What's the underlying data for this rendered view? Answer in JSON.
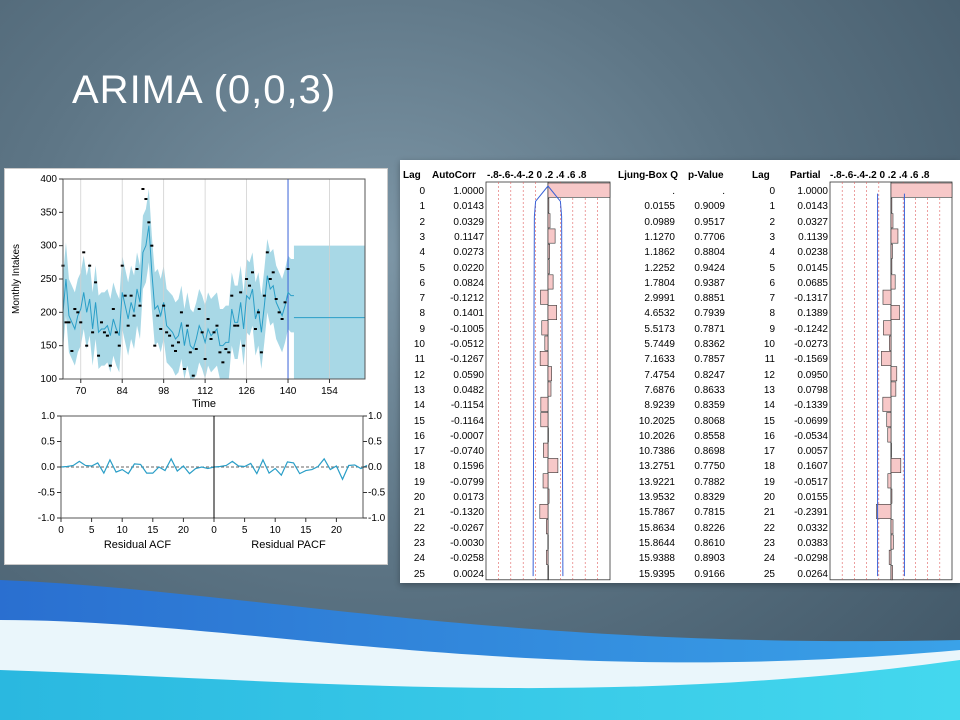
{
  "slide_title": "ARIMA (0,0,3)",
  "colors": {
    "band": "#a8d8e6",
    "line": "#2a9ec7",
    "bar_fill": "#f7c8c8",
    "bar_stroke": "#333333",
    "conf": "#3a62d8",
    "ref": "#e06060",
    "point": "#000000"
  },
  "chart_data": [
    {
      "type": "line",
      "name": "forecast",
      "ylabel": "Monthly Intakes",
      "xlabel": "Time",
      "xlim": [
        64,
        166
      ],
      "ylim": [
        100,
        400
      ],
      "x_ticks": [
        "70",
        "84",
        "98",
        "112",
        "126",
        "140",
        "154"
      ],
      "y_ticks": [
        "400",
        "350",
        "300",
        "250",
        "200",
        "150",
        "100"
      ],
      "forecast_start": 140,
      "actual": {
        "x": [
          64,
          65,
          66,
          67,
          68,
          69,
          70,
          71,
          72,
          73,
          74,
          75,
          76,
          77,
          78,
          79,
          80,
          81,
          82,
          83,
          84,
          85,
          86,
          87,
          88,
          89,
          90,
          91,
          92,
          93,
          94,
          95,
          96,
          97,
          98,
          99,
          100,
          101,
          102,
          103,
          104,
          105,
          106,
          107,
          108,
          109,
          110,
          111,
          112,
          113,
          114,
          115,
          116,
          117,
          118,
          119,
          120,
          121,
          122,
          123,
          124,
          125,
          126,
          127,
          128,
          129,
          130,
          131,
          132,
          133,
          134,
          135,
          136,
          137,
          138,
          139,
          140
        ],
        "y": [
          270,
          185,
          185,
          142,
          205,
          200,
          185,
          290,
          150,
          270,
          170,
          245,
          135,
          185,
          170,
          165,
          120,
          205,
          170,
          150,
          270,
          225,
          180,
          225,
          195,
          265,
          210,
          385,
          370,
          335,
          300,
          150,
          195,
          175,
          210,
          170,
          165,
          150,
          142,
          155,
          200,
          115,
          180,
          140,
          105,
          145,
          205,
          170,
          130,
          190,
          160,
          170,
          180,
          140,
          125,
          145,
          140,
          225,
          180,
          180,
          230,
          150,
          250,
          240,
          260,
          175,
          200,
          140,
          225,
          290,
          250,
          260,
          220,
          200,
          190,
          215,
          265
        ]
      },
      "fitted": {
        "x": [
          64,
          65,
          66,
          67,
          68,
          69,
          70,
          71,
          72,
          73,
          74,
          75,
          76,
          77,
          78,
          79,
          80,
          81,
          82,
          83,
          84,
          85,
          86,
          87,
          88,
          89,
          90,
          91,
          92,
          93,
          94,
          95,
          96,
          97,
          98,
          99,
          100,
          101,
          102,
          103,
          104,
          105,
          106,
          107,
          108,
          109,
          110,
          111,
          112,
          113,
          114,
          115,
          116,
          117,
          118,
          119,
          120,
          121,
          122,
          123,
          124,
          125,
          126,
          127,
          128,
          129,
          130,
          131,
          132,
          133,
          134,
          135,
          136,
          137,
          138,
          139,
          140,
          141,
          142
        ],
        "y": [
          200,
          250,
          195,
          185,
          175,
          195,
          205,
          230,
          200,
          220,
          175,
          215,
          170,
          175,
          175,
          180,
          165,
          190,
          175,
          165,
          230,
          210,
          190,
          215,
          200,
          235,
          215,
          290,
          300,
          330,
          260,
          205,
          210,
          195,
          215,
          180,
          175,
          170,
          160,
          165,
          185,
          150,
          175,
          150,
          145,
          160,
          180,
          170,
          155,
          175,
          165,
          170,
          175,
          150,
          150,
          155,
          155,
          205,
          185,
          185,
          215,
          175,
          225,
          220,
          235,
          190,
          205,
          170,
          210,
          255,
          235,
          240,
          215,
          205,
          195,
          210,
          230,
          225,
          225
        ]
      },
      "forecast": {
        "x": [
          142,
          166
        ],
        "y": [
          192,
          192
        ]
      },
      "band_upper_forecast": 300,
      "band_lower_forecast": 100
    },
    {
      "type": "line",
      "name": "residual_acf_pacf",
      "xlabel_left": "Residual ACF",
      "xlabel_right": "Residual PACF",
      "ylim": [
        -1,
        1
      ],
      "y_ticks": [
        "1.0",
        "0.5",
        "0.0",
        "-0.5",
        "-1.0"
      ],
      "x_ticks": [
        "0",
        "5",
        "10",
        "15",
        "20",
        "0",
        "5",
        "10",
        "15",
        "20"
      ],
      "acf": [
        0.0,
        0.01,
        0.03,
        0.11,
        0.03,
        0.02,
        0.08,
        -0.12,
        0.14,
        -0.1,
        -0.05,
        -0.13,
        0.06,
        0.05,
        -0.12,
        -0.12,
        0.0,
        -0.07,
        0.16,
        -0.08,
        0.02,
        -0.13,
        -0.03,
        0.0,
        -0.03,
        0.0
      ],
      "pacf": [
        0.0,
        0.01,
        0.03,
        0.11,
        0.02,
        0.01,
        0.07,
        -0.13,
        0.14,
        -0.12,
        -0.03,
        -0.16,
        0.1,
        0.08,
        -0.13,
        -0.07,
        -0.05,
        0.01,
        0.16,
        -0.05,
        0.02,
        -0.24,
        0.03,
        0.04,
        -0.03,
        0.03
      ]
    },
    {
      "type": "table",
      "name": "acf_pacf_table",
      "headers": {
        "lag": "Lag",
        "autocorr": "AutoCorr",
        "scale": "-.8-.6-.4-.2 0 .2 .4 .6 .8",
        "ljung": "Ljung-Box Q",
        "pvalue": "p-Value",
        "lag2": "Lag",
        "partial": "Partial",
        "scale2": "-.8-.6-.4-.2 0 .2 .4 .6 .8"
      },
      "rows": [
        {
          "lag": "0",
          "autocorr": "1.0000",
          "ljung": ".",
          "pvalue": ".",
          "partial": "1.0000"
        },
        {
          "lag": "1",
          "autocorr": "0.0143",
          "ljung": "0.0155",
          "pvalue": "0.9009",
          "partial": "0.0143"
        },
        {
          "lag": "2",
          "autocorr": "0.0329",
          "ljung": "0.0989",
          "pvalue": "0.9517",
          "partial": "0.0327"
        },
        {
          "lag": "3",
          "autocorr": "0.1147",
          "ljung": "1.1270",
          "pvalue": "0.7706",
          "partial": "0.1139"
        },
        {
          "lag": "4",
          "autocorr": "0.0273",
          "ljung": "1.1862",
          "pvalue": "0.8804",
          "partial": "0.0238"
        },
        {
          "lag": "5",
          "autocorr": "0.0220",
          "ljung": "1.2252",
          "pvalue": "0.9424",
          "partial": "0.0145"
        },
        {
          "lag": "6",
          "autocorr": "0.0824",
          "ljung": "1.7804",
          "pvalue": "0.9387",
          "partial": "0.0685"
        },
        {
          "lag": "7",
          "autocorr": "-0.1212",
          "ljung": "2.9991",
          "pvalue": "0.8851",
          "partial": "-0.1317"
        },
        {
          "lag": "8",
          "autocorr": "0.1401",
          "ljung": "4.6532",
          "pvalue": "0.7939",
          "partial": "0.1389"
        },
        {
          "lag": "9",
          "autocorr": "-0.1005",
          "ljung": "5.5173",
          "pvalue": "0.7871",
          "partial": "-0.1242"
        },
        {
          "lag": "10",
          "autocorr": "-0.0512",
          "ljung": "5.7449",
          "pvalue": "0.8362",
          "partial": "-0.0273"
        },
        {
          "lag": "11",
          "autocorr": "-0.1267",
          "ljung": "7.1633",
          "pvalue": "0.7857",
          "partial": "-0.1569"
        },
        {
          "lag": "12",
          "autocorr": "0.0590",
          "ljung": "7.4754",
          "pvalue": "0.8247",
          "partial": "0.0950"
        },
        {
          "lag": "13",
          "autocorr": "0.0482",
          "ljung": "7.6876",
          "pvalue": "0.8633",
          "partial": "0.0798"
        },
        {
          "lag": "14",
          "autocorr": "-0.1154",
          "ljung": "8.9239",
          "pvalue": "0.8359",
          "partial": "-0.1339"
        },
        {
          "lag": "15",
          "autocorr": "-0.1164",
          "ljung": "10.2025",
          "pvalue": "0.8068",
          "partial": "-0.0699"
        },
        {
          "lag": "16",
          "autocorr": "-0.0007",
          "ljung": "10.2026",
          "pvalue": "0.8558",
          "partial": "-0.0534"
        },
        {
          "lag": "17",
          "autocorr": "-0.0740",
          "ljung": "10.7386",
          "pvalue": "0.8698",
          "partial": "0.0057"
        },
        {
          "lag": "18",
          "autocorr": "0.1596",
          "ljung": "13.2751",
          "pvalue": "0.7750",
          "partial": "0.1607"
        },
        {
          "lag": "19",
          "autocorr": "-0.0799",
          "ljung": "13.9221",
          "pvalue": "0.7882",
          "partial": "-0.0517"
        },
        {
          "lag": "20",
          "autocorr": "0.0173",
          "ljung": "13.9532",
          "pvalue": "0.8329",
          "partial": "0.0155"
        },
        {
          "lag": "21",
          "autocorr": "-0.1320",
          "ljung": "15.7867",
          "pvalue": "0.7815",
          "partial": "-0.2391"
        },
        {
          "lag": "22",
          "autocorr": "-0.0267",
          "ljung": "15.8634",
          "pvalue": "0.8226",
          "partial": "0.0332"
        },
        {
          "lag": "23",
          "autocorr": "-0.0030",
          "ljung": "15.8644",
          "pvalue": "0.8610",
          "partial": "0.0383"
        },
        {
          "lag": "24",
          "autocorr": "-0.0258",
          "ljung": "15.9388",
          "pvalue": "0.8903",
          "partial": "-0.0298"
        },
        {
          "lag": "25",
          "autocorr": "0.0024",
          "ljung": "15.9395",
          "pvalue": "0.9166",
          "partial": "0.0264"
        }
      ]
    }
  ]
}
